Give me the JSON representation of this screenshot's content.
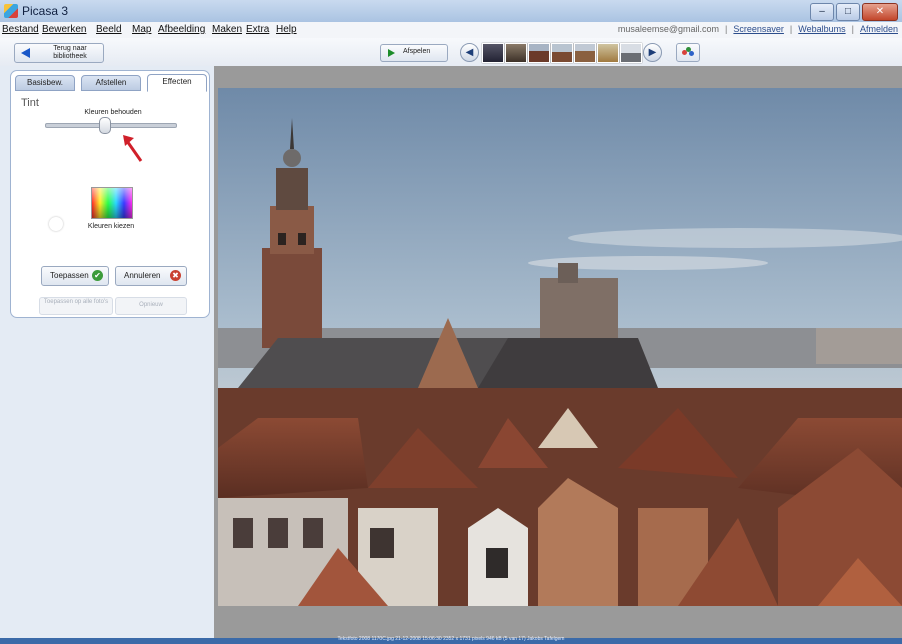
{
  "window": {
    "title": "Picasa 3",
    "minimize": "–",
    "maximize": "□",
    "close": "✕"
  },
  "menu": {
    "items": [
      "Bestand",
      "Bewerken",
      "Beeld",
      "Map",
      "Afbeelding",
      "Maken",
      "Extra",
      "Help"
    ],
    "account": "musaleemse@gmail.com",
    "links": [
      "Screensaver",
      "Webalbums",
      "Afmelden"
    ]
  },
  "toolbar": {
    "back_label": "Terug naar bibliotheek",
    "play_label": "Afspelen",
    "prev_glyph": "◀",
    "next_glyph": "▶"
  },
  "panel": {
    "tabs": [
      "Basisbew.",
      "Afstellen",
      "Effecten"
    ],
    "active_tab": "Effecten",
    "heading": "Tint",
    "slider_label": "Kleuren behouden",
    "slider_value": 0.45,
    "color_label": "Kleuren kiezen",
    "apply_label": "Toepassen",
    "cancel_label": "Annuleren",
    "disabled_left": "Toepassen op alle foto's",
    "disabled_right": "Opnieuw"
  },
  "status": {
    "text": "Tekstfoto 2008 1170C.jpg   21-12-2008 15:06:30   2352 x 1731 pixels   946 kB   (5 van 17)   Jakobs Tafelgem"
  },
  "colors": {
    "accent": "#3b6aa8",
    "apply_icon": "#3c9b3a",
    "cancel_icon": "#c94130",
    "arrow": "#d0202a"
  },
  "icons": [
    "picasa-logo-icon",
    "back-arrow-icon",
    "play-icon",
    "prev-icon",
    "next-icon",
    "effects-icon",
    "check-icon",
    "cancel-icon",
    "red-pointer-icon"
  ]
}
